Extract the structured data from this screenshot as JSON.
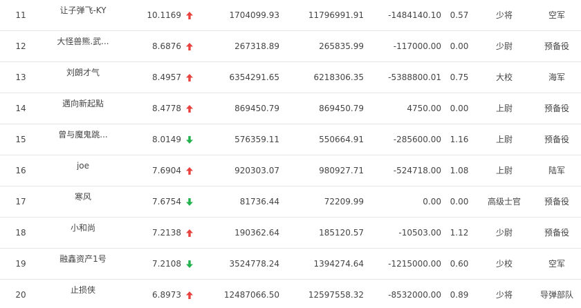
{
  "rows": [
    {
      "rank": "11",
      "name": "让子弹飞-KY",
      "score": "10.1169",
      "trend": "up",
      "v1": "1704099.93",
      "v2": "11796991.91",
      "v3": "-1484140.10",
      "ratio": "0.57",
      "rank_name": "少将",
      "branch": "空军"
    },
    {
      "rank": "12",
      "name": "大怪兽熊.武...",
      "score": "8.6876",
      "trend": "up",
      "v1": "267318.89",
      "v2": "265835.99",
      "v3": "-117000.00",
      "ratio": "0.00",
      "rank_name": "少尉",
      "branch": "预备役"
    },
    {
      "rank": "13",
      "name": "刘朗才气",
      "score": "8.4957",
      "trend": "up",
      "v1": "6354291.65",
      "v2": "6218306.35",
      "v3": "-5388800.01",
      "ratio": "0.75",
      "rank_name": "大校",
      "branch": "海军"
    },
    {
      "rank": "14",
      "name": "邁向新起點",
      "score": "8.4778",
      "trend": "up",
      "v1": "869450.79",
      "v2": "869450.79",
      "v3": "4750.00",
      "ratio": "0.00",
      "rank_name": "上尉",
      "branch": "预备役"
    },
    {
      "rank": "15",
      "name": "曾与魔鬼跳...",
      "score": "8.0149",
      "trend": "down",
      "v1": "576359.11",
      "v2": "550664.91",
      "v3": "-285600.00",
      "ratio": "1.16",
      "rank_name": "上尉",
      "branch": "预备役"
    },
    {
      "rank": "16",
      "name": "joe",
      "score": "7.6904",
      "trend": "up",
      "v1": "920303.07",
      "v2": "980927.71",
      "v3": "-524718.00",
      "ratio": "1.08",
      "rank_name": "上尉",
      "branch": "陆军"
    },
    {
      "rank": "17",
      "name": "寒风",
      "score": "7.6754",
      "trend": "down",
      "v1": "81736.44",
      "v2": "72209.99",
      "v3": "0.00",
      "ratio": "0.00",
      "rank_name": "高级士官",
      "branch": "预备役"
    },
    {
      "rank": "18",
      "name": "小和尚",
      "score": "7.2138",
      "trend": "up",
      "v1": "190362.64",
      "v2": "185120.57",
      "v3": "-10503.00",
      "ratio": "1.12",
      "rank_name": "少尉",
      "branch": "预备役"
    },
    {
      "rank": "19",
      "name": "融鑫资产1号",
      "score": "7.2108",
      "trend": "down",
      "v1": "3524778.24",
      "v2": "1394274.64",
      "v3": "-1215000.00",
      "ratio": "0.60",
      "rank_name": "少校",
      "branch": "空军"
    },
    {
      "rank": "20",
      "name": "止损侠",
      "score": "6.8973",
      "trend": "up",
      "v1": "12487066.50",
      "v2": "12597558.32",
      "v3": "-8532000.00",
      "ratio": "0.89",
      "rank_name": "少将",
      "branch": "导弹部队"
    }
  ],
  "colors": {
    "up": "#e8423f",
    "down": "#23b14d",
    "text": "#444444",
    "divider": "#e6e6e6"
  },
  "icons": {
    "up": "arrow-up-icon",
    "down": "arrow-down-icon"
  }
}
